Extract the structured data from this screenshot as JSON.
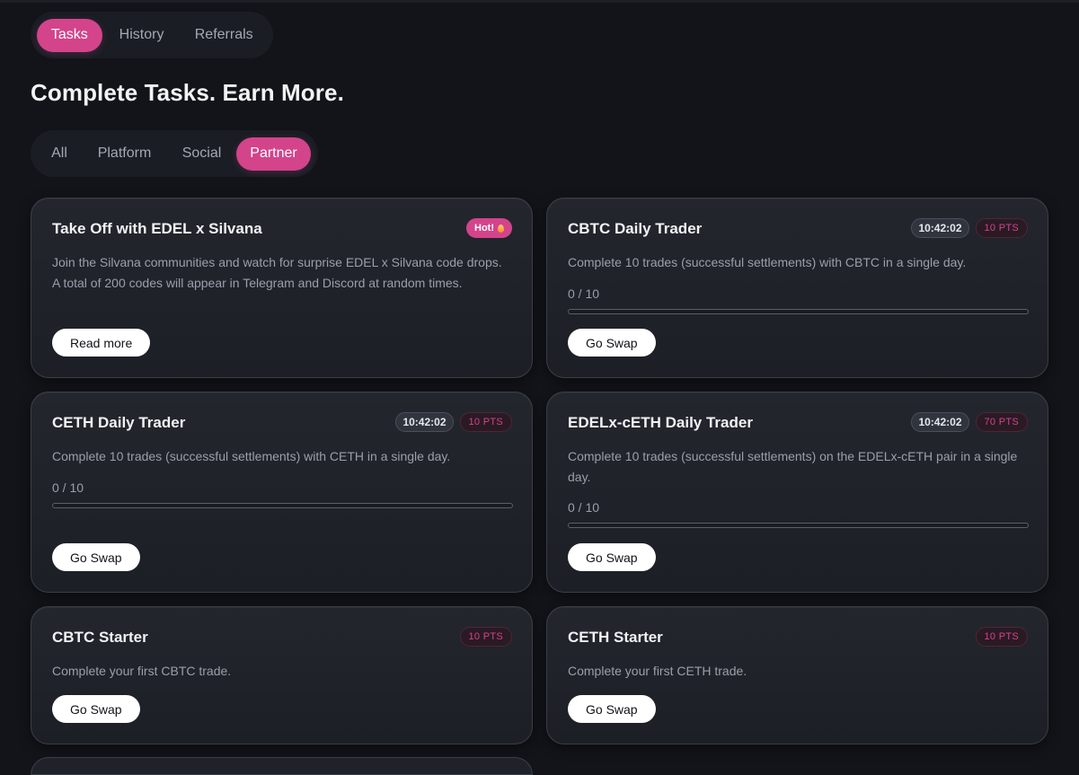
{
  "main_tabs": [
    {
      "label": "Tasks",
      "active": true
    },
    {
      "label": "History",
      "active": false
    },
    {
      "label": "Referrals",
      "active": false
    }
  ],
  "page_title": "Complete Tasks. Earn More.",
  "filter_tabs": [
    {
      "label": "All",
      "active": false
    },
    {
      "label": "Platform",
      "active": false
    },
    {
      "label": "Social",
      "active": false
    },
    {
      "label": "Partner",
      "active": true
    }
  ],
  "colors": {
    "accent": "#d3448b",
    "background": "#121419",
    "card": "#1f2228"
  },
  "cards": [
    {
      "title": "Take Off with EDEL x Silvana",
      "hot_label": "Hot!",
      "hot_icon": "fire-icon",
      "description": "Join the Silvana communities and watch for surprise EDEL x Silvana code drops. A total of 200 codes will appear in Telegram and Discord at random times.",
      "button": "Read more"
    },
    {
      "title": "CBTC Daily Trader",
      "timer": "10:42:02",
      "points": "10 PTS",
      "description": "Complete 10 trades (successful settlements) with CBTC in a single day.",
      "progress_text": "0 / 10",
      "progress_fraction": 0,
      "button": "Go Swap"
    },
    {
      "title": "CETH Daily Trader",
      "timer": "10:42:02",
      "points": "10 PTS",
      "description": "Complete 10 trades (successful settlements) with CETH in a single day.",
      "progress_text": "0 / 10",
      "progress_fraction": 0,
      "button": "Go Swap"
    },
    {
      "title": "EDELx-cETH Daily Trader",
      "timer": "10:42:02",
      "points": "70 PTS",
      "description": "Complete 10 trades (successful settlements) on the EDELx-cETH pair in a single day.",
      "progress_text": "0 / 10",
      "progress_fraction": 0,
      "button": "Go Swap"
    },
    {
      "title": "CBTC Starter",
      "points": "10 PTS",
      "description": "Complete your first CBTC trade.",
      "button": "Go Swap"
    },
    {
      "title": "CETH Starter",
      "points": "10 PTS",
      "description": "Complete your first CETH trade.",
      "button": "Go Swap"
    }
  ]
}
